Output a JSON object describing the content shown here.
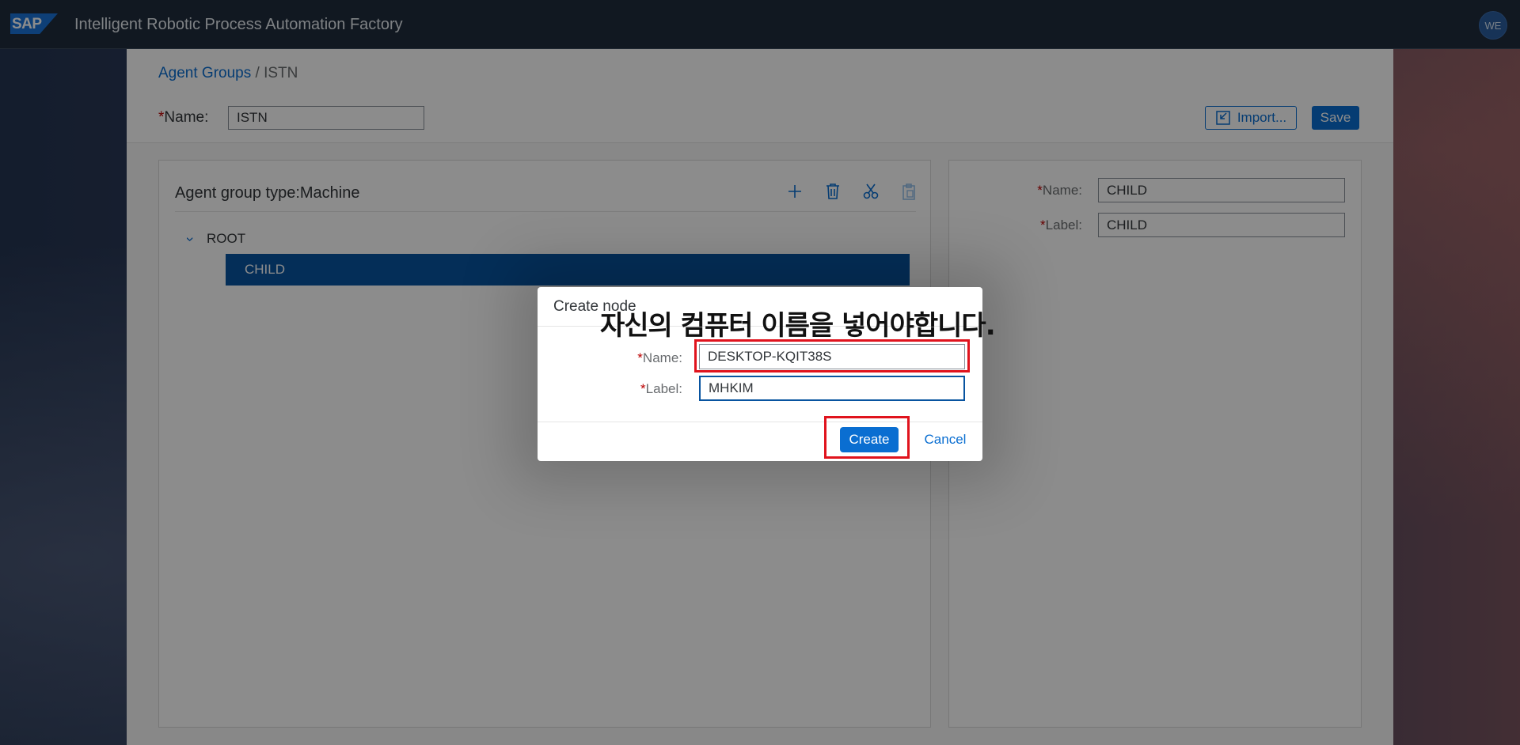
{
  "shell": {
    "logo_text": "SAP",
    "title": "Intelligent Robotic Process Automation Factory",
    "avatar_initials": "WE"
  },
  "header": {
    "breadcrumb_link": "Agent Groups",
    "breadcrumb_separator": " / ",
    "breadcrumb_current": "ISTN",
    "required_mark": "*",
    "name_label": "Name:",
    "name_value": "ISTN",
    "import_label": "Import...",
    "save_label": "Save"
  },
  "tree": {
    "title": "Agent group type:Machine",
    "toolbar_icons": [
      "add-icon",
      "delete-icon",
      "cut-icon",
      "paste-icon"
    ],
    "root_label": "ROOT",
    "child_label": "CHILD"
  },
  "detail": {
    "required_mark": "*",
    "name_label": "Name:",
    "name_value": "CHILD",
    "label_label": "Label:",
    "label_value": "CHILD"
  },
  "dialog": {
    "title": "Create node",
    "required_mark": "*",
    "name_label": "Name:",
    "name_value": "DESKTOP-KQIT38S",
    "label_label": "Label:",
    "label_value": "MHKIM",
    "create_label": "Create",
    "cancel_label": "Cancel"
  },
  "annotation": {
    "text": "자신의 컴퓨터 이름을 넣어야합니다.",
    "highlight_color": "#e0131d"
  },
  "colors": {
    "brand_blue": "#0a6ed1",
    "selected_row": "#0854a0",
    "shellbar": "#1f2c3d",
    "required": "#bb0000"
  }
}
